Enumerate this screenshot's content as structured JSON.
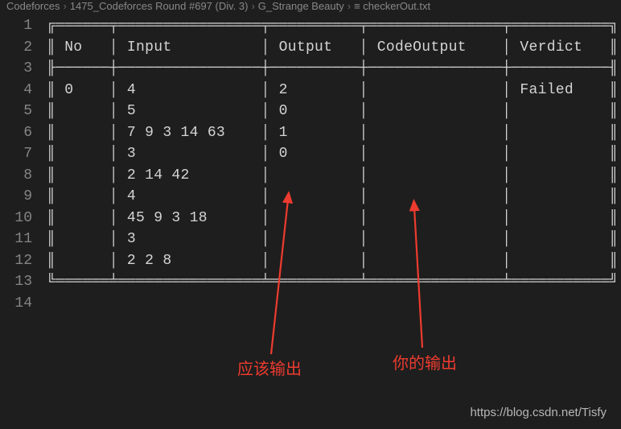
{
  "breadcrumb": {
    "items": [
      "Codeforces",
      "1475_Codeforces Round #697 (Div. 3)",
      "G_Strange Beauty",
      "≡ checkerOut.txt"
    ]
  },
  "lines": {
    "count": 14
  },
  "table": {
    "headers": [
      "No",
      "Input",
      "Output",
      "CodeOutput",
      "Verdict"
    ],
    "row": {
      "no": "0",
      "input": [
        "4",
        "5",
        "7 9 3 14 63",
        "3",
        "2 14 42",
        "4",
        "45 9 3 18",
        "3",
        "2 2 8"
      ],
      "output": [
        "2",
        "0",
        "1",
        "0"
      ],
      "codeOutput": [],
      "verdict": "Failed"
    }
  },
  "annotations": {
    "expected": "应该输出",
    "yours": "你的输出"
  },
  "watermark": "https://blog.csdn.net/Tisfy"
}
